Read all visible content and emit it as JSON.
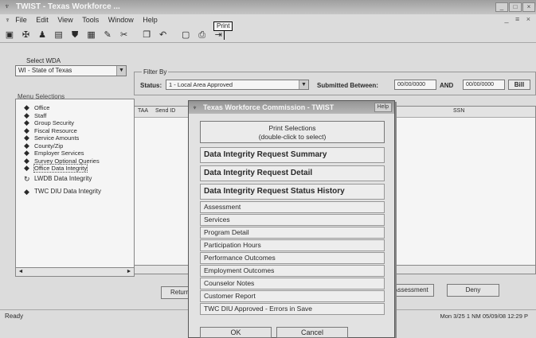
{
  "window": {
    "title": "TWIST - Texas Workforce ...",
    "controls": [
      "_",
      "□",
      "×"
    ]
  },
  "menubar": {
    "items": [
      "File",
      "Edit",
      "View",
      "Tools",
      "Window",
      "Help"
    ]
  },
  "toolbar": {
    "tooltip": "Print"
  },
  "left": {
    "select_wda_label": "Select WDA",
    "select_wda_value": "WI - State of Texas",
    "menu_selections_label": "Menu Selections",
    "items": [
      {
        "label": "Office",
        "icon": "diamond-icon"
      },
      {
        "label": "Staff",
        "icon": "diamond-icon"
      },
      {
        "label": "Group Security",
        "icon": "diamond-icon"
      },
      {
        "label": "Fiscal Resource",
        "icon": "diamond-icon"
      },
      {
        "label": "Service Amounts",
        "icon": "diamond-icon"
      },
      {
        "label": "County/Zip",
        "icon": "diamond-icon"
      },
      {
        "label": "Employer Services",
        "icon": "diamond-icon"
      },
      {
        "label": "Survey Optional Queries",
        "icon": "diamond-icon"
      },
      {
        "label": "Office Data Integrity",
        "icon": "diamond-icon"
      },
      {
        "label": "LWDB Data Integrity",
        "icon": "refresh-icon"
      },
      {
        "label": "TWC DIU Data Integrity",
        "icon": "diamond-icon"
      }
    ]
  },
  "filter": {
    "label": "Filter By",
    "status_label": "Status:",
    "status_value": "1 - Local Area Approved",
    "submitted_label": "Submitted Between:",
    "date_from": "00/00/0000",
    "and_label": "AND",
    "date_to": "00/00/0000",
    "bill_button": "Bill"
  },
  "grid": {
    "columns": [
      "TAA",
      "Send ID",
      "SSN"
    ]
  },
  "buttons": {
    "return": "Return",
    "assessment": "Assessment",
    "deny": "Deny"
  },
  "statusbar": {
    "left": "Ready",
    "right": "Mon 3/25 1 NM 05/09/08 12:29 P"
  },
  "popup": {
    "title": "Texas Workforce Commission - TWIST",
    "help_label": "Help",
    "print_selections_line1": "Print Selections",
    "print_selections_line2": "(double-click to select)",
    "options_bold": [
      "Data Integrity Request Summary",
      "Data Integrity Request Detail",
      "Data Integrity Request Status History"
    ],
    "options": [
      "Assessment",
      "Services",
      "Program Detail",
      "Participation Hours",
      "Performance Outcomes",
      "Employment Outcomes",
      "Counselor Notes",
      "Customer Report",
      "TWC DIU Approved - Errors in Save"
    ],
    "ok_label": "OK",
    "cancel_label": "Cancel"
  }
}
